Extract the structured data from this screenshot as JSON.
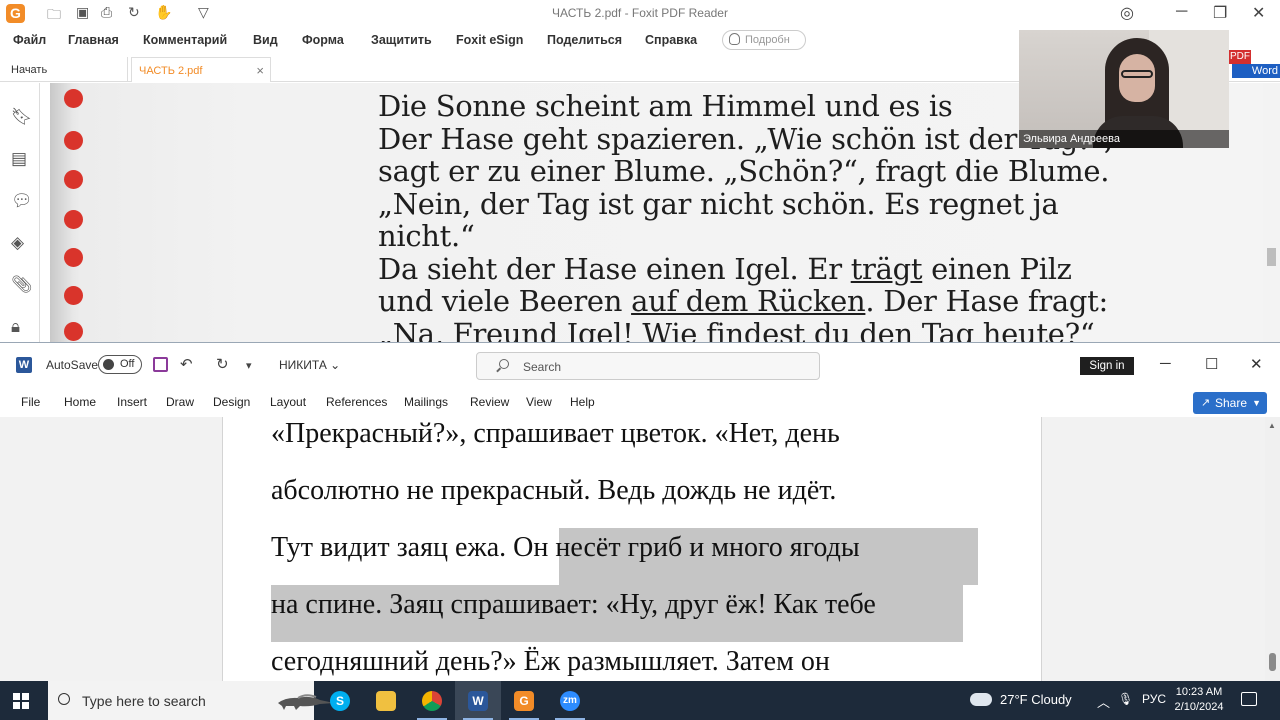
{
  "foxit": {
    "title": "ЧАСТЬ 2.pdf - Foxit PDF Reader",
    "menu": [
      "Файл",
      "Главная",
      "Комментарий",
      "Вид",
      "Форма",
      "Защитить",
      "Foxit eSign",
      "Поделиться",
      "Справка"
    ],
    "search_placeholder": "Подробн",
    "tabs": [
      "Начать",
      "ЧАСТЬ 2.pdf"
    ],
    "page_lines": [
      "Die Sonne scheint am Himmel und es is",
      "Der Hase geht spazieren. „Wie schön ist der Tag!“,",
      "sagt er zu einer Blume. „Schön?“, fragt die Blume.",
      "„Nein, der Tag ist gar nicht schön. Es regnet ja",
      "nicht.“",
      "Da sieht der Hase einen Igel. Er trägt einen Pilz",
      "und viele Beeren auf dem Rücken. Der Hase fragt:",
      "„Na, Freund Igel! Wie findest du den Tag heute?“"
    ],
    "line6": {
      "pre": "Da sieht der Hase einen Igel. Er ",
      "u": "trägt",
      "post": " einen Pilz"
    },
    "line7": {
      "pre": "und viele Beeren ",
      "u": "auf dem Rücken",
      "post": ". Der Hase fragt:"
    },
    "badge_pdf": "PDF",
    "badge_word": "Word"
  },
  "webcam": {
    "participant_name": "Эльвира Андреева"
  },
  "word": {
    "autosave_label": "AutoSave",
    "autosave_state": "Off",
    "doc_title": "НИКИТА",
    "search_placeholder": "Search",
    "signin_label": "Sign in",
    "ribbon_tabs": [
      "File",
      "Home",
      "Insert",
      "Draw",
      "Design",
      "Layout",
      "References",
      "Mailings",
      "Review",
      "View",
      "Help"
    ],
    "share_label": "Share",
    "doc_lines": [
      "«Прекрасный?», спрашивает цветок. «Нет, день",
      "абсолютно не прекрасный. Ведь дождь не идёт.",
      "Тут видит заяц ежа. Он несёт гриб и много ягоды",
      "на спине. Заяц спрашивает: «Ну, друг ёж! Как тебе",
      "сегодняшний день?» Ёж размышляет. Затем он"
    ],
    "selection_fraction_of_line3": 0.42
  },
  "taskbar": {
    "search_placeholder": "Type here to search",
    "apps": [
      "skype-icon",
      "file-explorer-icon",
      "chrome-icon",
      "word-icon",
      "foxit-icon",
      "zoom-icon"
    ],
    "weather": "27°F  Cloudy",
    "language": "РУС",
    "time": "10:23 AM",
    "date": "2/10/2024"
  },
  "colors": {
    "foxit_orange": "#f28c28",
    "word_blue": "#2b579a",
    "share_blue": "#2b6fc9",
    "selection_gray": "#c5c5c5",
    "taskbar": "#1d2a3a",
    "pdf_dot_red": "#d9342b"
  }
}
